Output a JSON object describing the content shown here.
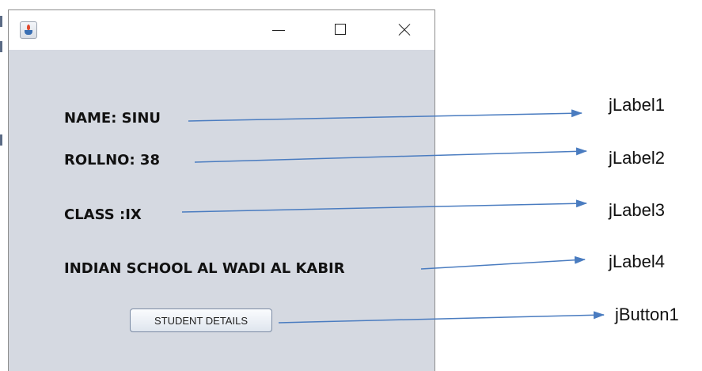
{
  "window": {
    "title": "",
    "icon": "java-coffee-cup-icon",
    "controls": [
      "minimize-icon",
      "maximize-icon",
      "close-icon"
    ]
  },
  "labels": {
    "name": "NAME: SINU",
    "rollno": "ROLLNO: 38",
    "class": "CLASS :IX",
    "school": "INDIAN SCHOOL AL WADI AL KABIR"
  },
  "button": {
    "label": "STUDENT DETAILS"
  },
  "callouts": {
    "label1": "jLabel1",
    "label2": "jLabel2",
    "label3": "jLabel3",
    "label4": "jLabel4",
    "button1": "jButton1"
  },
  "colors": {
    "window_background": "#d5d9e1",
    "arrow": "#4a7cc0"
  }
}
